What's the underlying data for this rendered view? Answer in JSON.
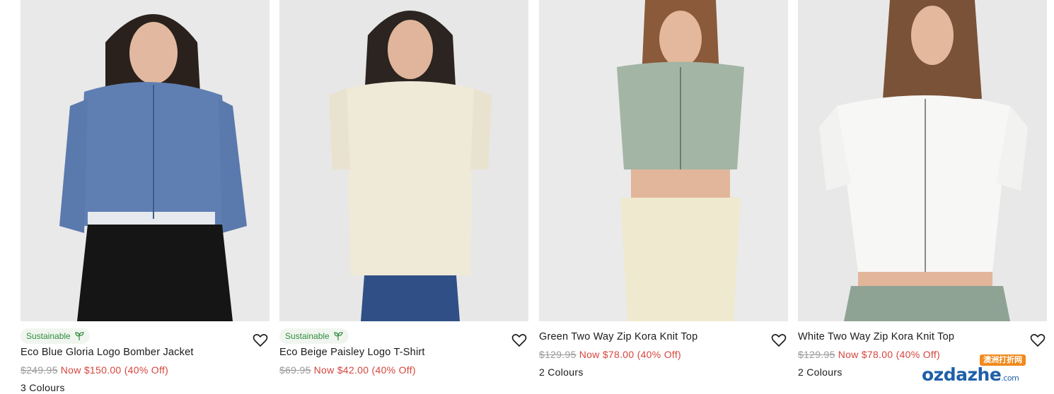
{
  "products": [
    {
      "sustainable_label": "Sustainable",
      "name": "Eco Blue Gloria Logo Bomber Jacket",
      "was_price": "$249.95",
      "now_price": "Now $150.00 (40% Off)",
      "colours": "3 Colours"
    },
    {
      "sustainable_label": "Sustainable",
      "name": "Eco Beige Paisley Logo T-Shirt",
      "was_price": "$69.95",
      "now_price": "Now $42.00 (40% Off)",
      "colours": ""
    },
    {
      "name": "Green Two Way Zip Kora Knit Top",
      "was_price": "$129.95",
      "now_price": "Now $78.00 (40% Off)",
      "colours": "2 Colours"
    },
    {
      "name": "White Two Way Zip Kora Knit Top",
      "was_price": "$129.95",
      "now_price": "Now $78.00 (40% Off)",
      "colours": "2 Colours"
    }
  ],
  "watermark": {
    "tag": "澳洲打折网",
    "main": "ozdazhe",
    "suffix": ".com"
  },
  "colors": {
    "sale_red": "#d6453d",
    "sustainable_green": "#2e8b3e",
    "strike_grey": "#9a9a9a"
  },
  "icons": [
    "leaf-icon",
    "heart-icon"
  ]
}
